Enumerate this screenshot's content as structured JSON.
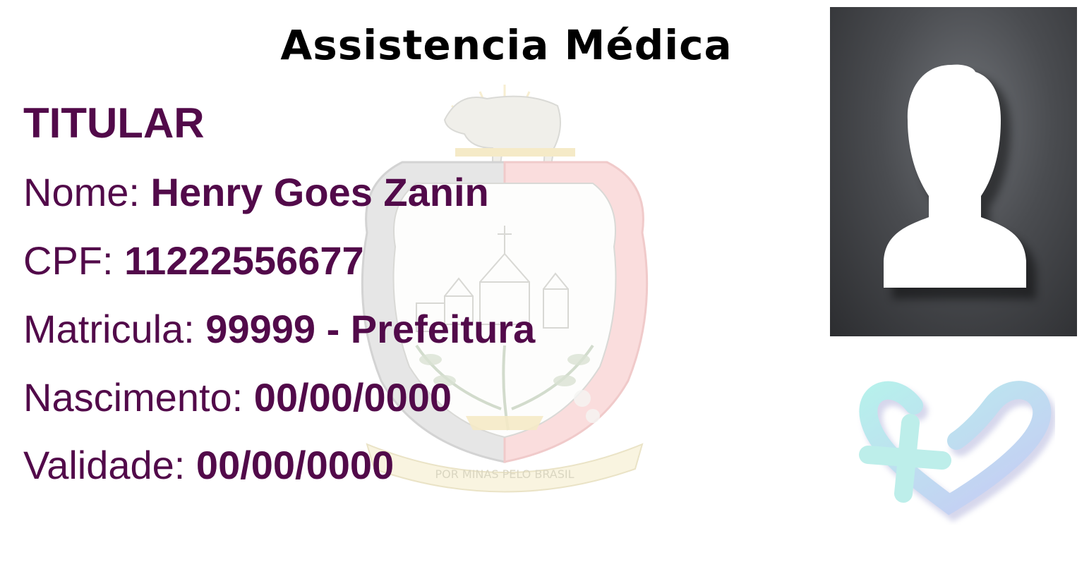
{
  "card": {
    "title": "Assistencia Médica",
    "section": "TITULAR",
    "fields": [
      {
        "label": "Nome:",
        "value": "Henry Goes Zanin"
      },
      {
        "label": "CPF:",
        "value": "11222556677"
      },
      {
        "label": "Matricula:",
        "value": "99999 - Prefeitura"
      },
      {
        "label": "Nascimento:",
        "value": "00/00/0000"
      },
      {
        "label": "Validade:",
        "value": "00/00/0000"
      }
    ],
    "crest_motto": "POR MINAS PELO BRASIL"
  },
  "colors": {
    "text": "#520a4a",
    "title": "#000000",
    "photo_bg": "#3a3b3f"
  },
  "icons": {
    "photo": "person-silhouette-icon",
    "logo": "heart-cross-logo-icon",
    "watermark": "municipal-crest-icon"
  }
}
